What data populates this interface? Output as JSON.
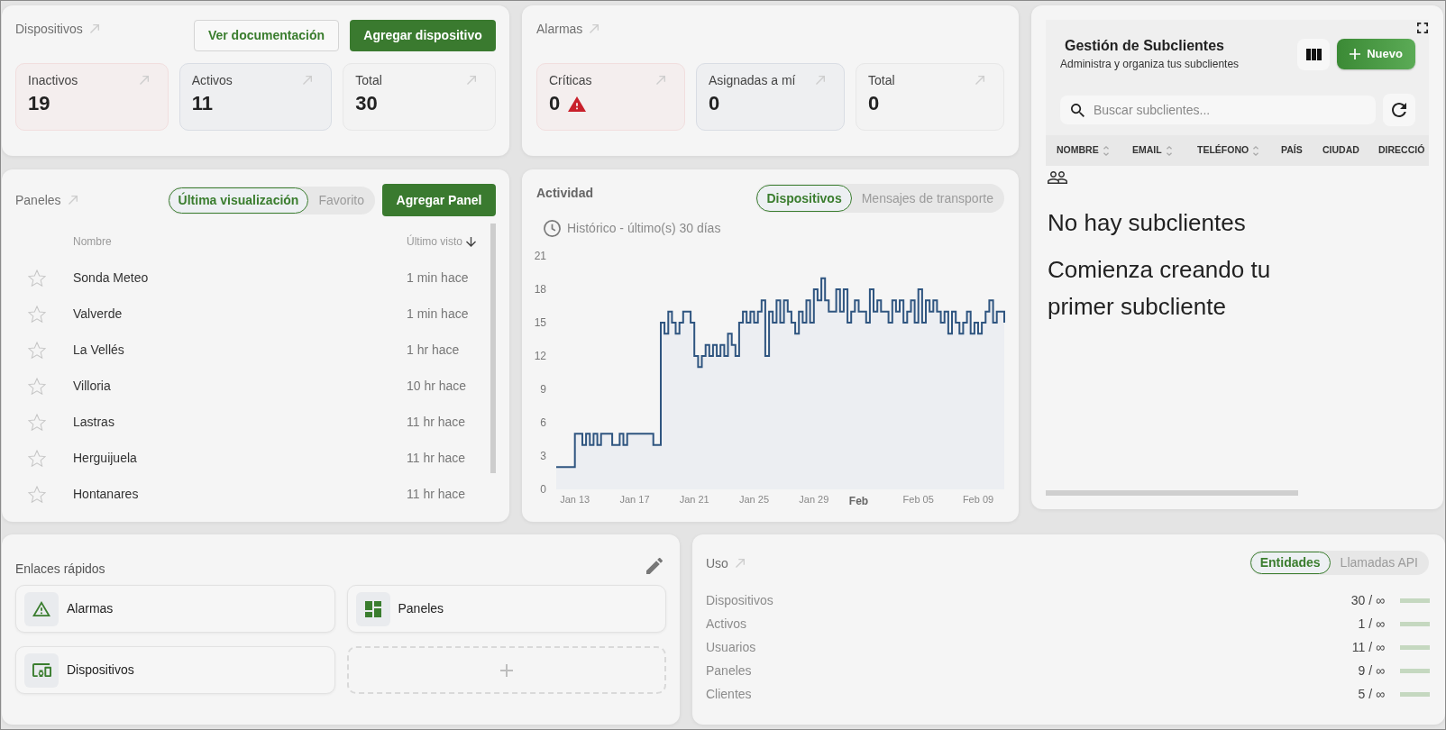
{
  "devices_card": {
    "title": "Dispositivos",
    "buttons": [
      {
        "label": "Ver documentación",
        "kind": "outline"
      },
      {
        "label": "Agregar dispositivo",
        "kind": "primary"
      }
    ],
    "stats": [
      {
        "label": "Inactivos",
        "value": "19",
        "kind": "danger"
      },
      {
        "label": "Activos",
        "value": "11",
        "kind": "info"
      },
      {
        "label": "Total",
        "value": "30",
        "kind": "neutral"
      }
    ]
  },
  "alarms_card": {
    "title": "Alarmas",
    "stats": [
      {
        "label": "Críticas",
        "value": "0",
        "kind": "danger",
        "warning": true
      },
      {
        "label": "Asignadas a mí",
        "value": "0",
        "kind": "info",
        "warning": false
      },
      {
        "label": "Total",
        "value": "0",
        "kind": "neutral",
        "warning": false
      }
    ]
  },
  "subclients_card": {
    "title": "Gestión de Subclientes",
    "subtitle": "Administra y organiza tus subclientes",
    "new_button": "Nuevo",
    "search": {
      "placeholder": "Buscar subclientes..."
    },
    "columns": [
      {
        "label": "NOMBRE",
        "sortable": true
      },
      {
        "label": "EMAIL",
        "sortable": true
      },
      {
        "label": "TELÉFONO",
        "sortable": true
      },
      {
        "label": "PAÍS",
        "sortable": false
      },
      {
        "label": "CIUDAD",
        "sortable": false
      },
      {
        "label": "DIRECCIÓ",
        "sortable": false
      }
    ],
    "empty_title": "No hay subclientes",
    "empty_message": "Comienza creando tu primer subcliente"
  },
  "panels_card": {
    "title": "Paneles",
    "tabs": [
      {
        "label": "Última visualización",
        "selected": true
      },
      {
        "label": "Favorito",
        "selected": false
      }
    ],
    "add_button": "Agregar Panel",
    "columns": [
      {
        "label": "Nombre",
        "sorted": false
      },
      {
        "label": "Último visto",
        "sorted": true
      }
    ],
    "rows": [
      {
        "name": "Sonda Meteo",
        "last_seen": "1 min hace",
        "favorite": false
      },
      {
        "name": "Valverde",
        "last_seen": "1 min hace",
        "favorite": false
      },
      {
        "name": "La Vellés",
        "last_seen": "1 hr hace",
        "favorite": false
      },
      {
        "name": "Villoria",
        "last_seen": "10 hr hace",
        "favorite": false
      },
      {
        "name": "Lastras",
        "last_seen": "11 hr hace",
        "favorite": false
      },
      {
        "name": "Herguijuela",
        "last_seen": "11 hr hace",
        "favorite": false
      },
      {
        "name": "Hontanares",
        "last_seen": "11 hr hace",
        "favorite": false
      }
    ]
  },
  "activity_card": {
    "title": "Actividad",
    "tabs": [
      {
        "label": "Dispositivos",
        "selected": true
      },
      {
        "label": "Mensajes de transporte",
        "selected": false
      }
    ],
    "range_label": "Histórico - último(s) 30 días",
    "chart_data": {
      "type": "area",
      "categories": [
        null,
        null,
        null,
        null,
        null,
        "Jan 13",
        null,
        null,
        null,
        null,
        null,
        null,
        null,
        null,
        null,
        null,
        null,
        null,
        null,
        null,
        null,
        "Jan 17",
        null,
        null,
        null,
        null,
        null,
        null,
        null,
        null,
        null,
        null,
        null,
        null,
        null,
        null,
        null,
        "Jan 21",
        null,
        null,
        null,
        null,
        null,
        null,
        null,
        null,
        null,
        null,
        null,
        null,
        null,
        null,
        null,
        "Jan 25",
        null,
        null,
        null,
        null,
        null,
        null,
        null,
        null,
        null,
        null,
        null,
        null,
        null,
        null,
        null,
        "Jan 29",
        null,
        null,
        null,
        null,
        null,
        null,
        null,
        null,
        null,
        null,
        null,
        "Feb",
        null,
        null,
        null,
        null,
        null,
        null,
        null,
        null,
        null,
        null,
        null,
        null,
        null,
        null,
        null,
        "Feb 05",
        null,
        null,
        null,
        null,
        null,
        null,
        null,
        null,
        null,
        null,
        null,
        null,
        null,
        null,
        null,
        "Feb 09",
        null,
        null,
        null,
        null,
        null,
        null,
        null
      ],
      "series": [
        {
          "color": "#2f5580",
          "values": [
            2,
            2,
            2,
            2,
            2,
            5,
            5,
            4,
            5,
            4,
            5,
            4,
            5,
            5,
            5,
            4,
            4,
            5,
            4,
            5,
            5,
            5,
            5,
            5,
            5,
            5,
            4,
            4,
            15,
            14,
            16,
            15,
            14,
            15,
            16,
            16,
            15,
            12,
            11,
            12,
            13,
            12,
            13,
            12,
            13,
            12,
            14,
            13,
            12,
            15,
            16,
            15,
            16,
            15,
            16,
            17,
            12,
            16,
            15,
            17,
            15,
            17,
            16,
            15,
            14,
            16,
            15,
            17,
            15,
            18,
            17,
            19,
            17,
            16,
            16,
            18,
            16,
            18,
            15,
            16,
            17,
            16,
            16,
            15,
            18,
            16,
            17,
            16,
            16,
            15,
            17,
            16,
            17,
            15,
            16,
            17,
            15,
            18,
            15,
            17,
            16,
            17,
            16,
            15,
            16,
            14,
            16,
            15,
            14,
            15,
            16,
            14,
            15,
            14,
            15,
            16,
            17,
            15,
            16,
            16,
            15
          ]
        }
      ],
      "ylim": [
        0,
        21
      ],
      "yticks": [
        0,
        3,
        6,
        9,
        12,
        15,
        18,
        21
      ]
    }
  },
  "quick_links_card": {
    "title": "Enlaces rápidos",
    "links": [
      {
        "label": "Alarmas",
        "kind": "alarms"
      },
      {
        "label": "Paneles",
        "kind": "dashboards"
      },
      {
        "label": "Dispositivos",
        "kind": "devices"
      }
    ]
  },
  "usage_card": {
    "title": "Uso",
    "tabs": [
      {
        "label": "Entidades",
        "selected": true
      },
      {
        "label": "Llamadas API",
        "selected": false
      }
    ],
    "rows": [
      {
        "label": "Dispositivos",
        "value": "30 / ∞",
        "level": 0
      },
      {
        "label": "Activos",
        "value": "1 / ∞",
        "level": 0
      },
      {
        "label": "Usuarios",
        "value": "11 / ∞",
        "level": 0
      },
      {
        "label": "Paneles",
        "value": "9 / ∞",
        "level": 0
      },
      {
        "label": "Clientes",
        "value": "5 / ∞",
        "level": 0
      }
    ]
  }
}
